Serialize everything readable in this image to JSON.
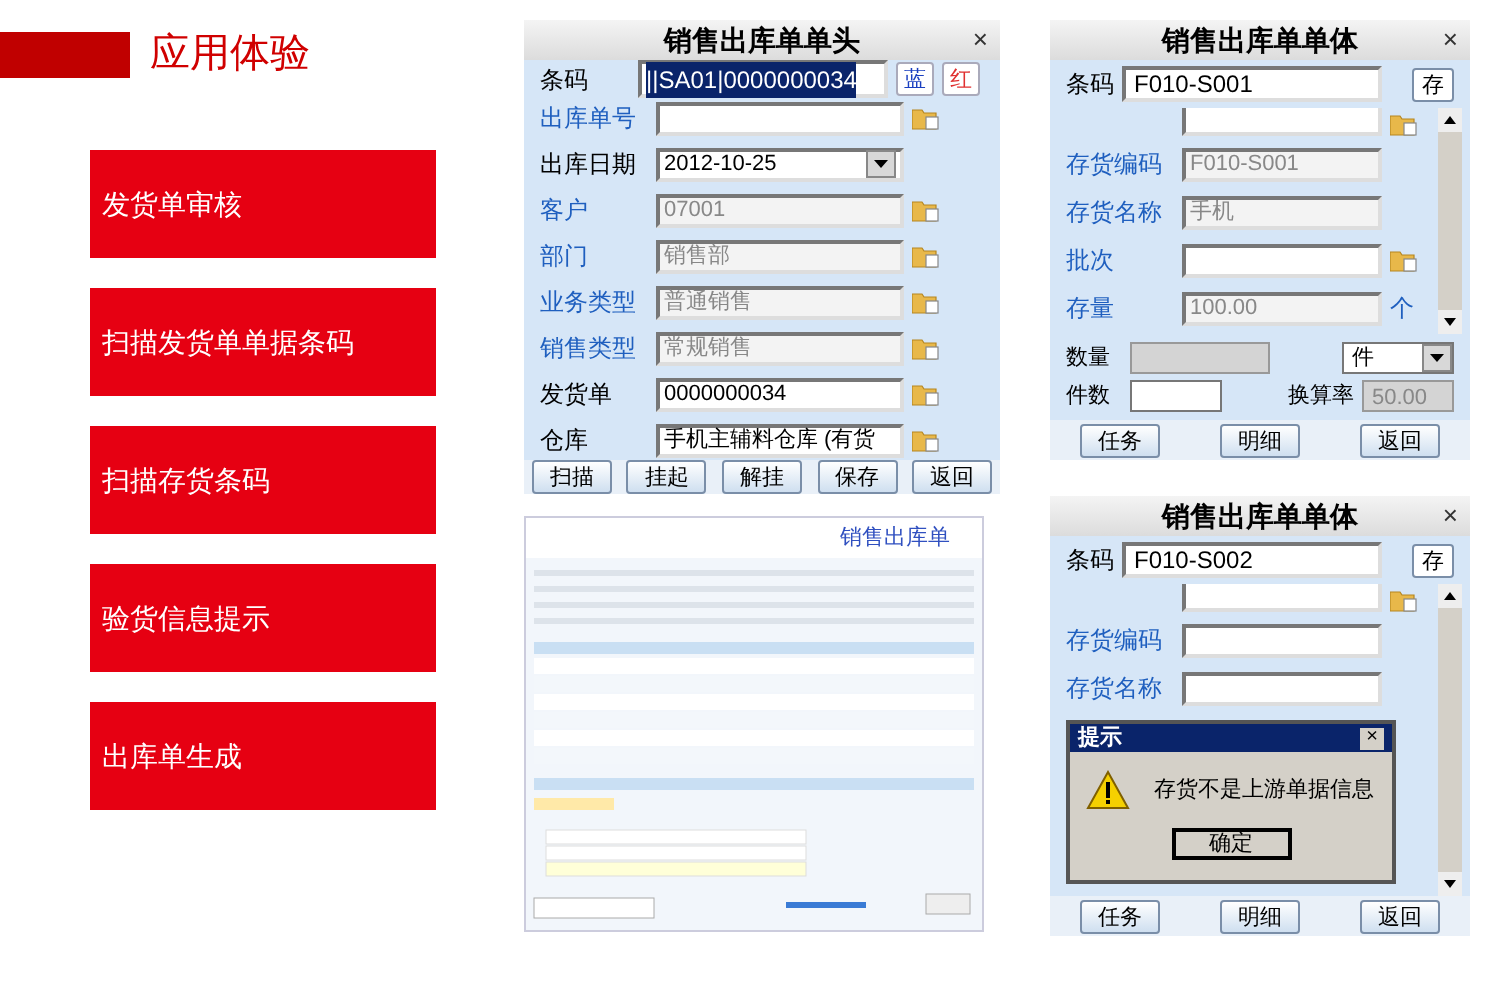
{
  "header": {
    "title": "应用体验"
  },
  "steps": [
    {
      "label": "发货单审核"
    },
    {
      "label": "扫描发货单单据条码"
    },
    {
      "label": "扫描存货条码"
    },
    {
      "label": "验货信息提示"
    },
    {
      "label": "出库单生成"
    }
  ],
  "head_form": {
    "title": "销售出库单单头",
    "close": "×",
    "barcode": {
      "label": "条码",
      "value": "||SA01|0000000034",
      "selected": true
    },
    "color_buttons": [
      {
        "label": "蓝",
        "color": "#1a3fc0"
      },
      {
        "label": "红",
        "color": "#e03030"
      }
    ],
    "fields": [
      {
        "label": "出库单号",
        "linked": true,
        "kind": "lookup",
        "disabled": false
      },
      {
        "label": "出库日期",
        "linked": false,
        "kind": "date",
        "value": "2012-10-25",
        "disabled": false
      },
      {
        "label": "客户",
        "linked": true,
        "kind": "lookup",
        "value": "07001",
        "disabled": true
      },
      {
        "label": "部门",
        "linked": true,
        "kind": "lookup",
        "value": "销售部",
        "disabled": true
      },
      {
        "label": "业务类型",
        "linked": true,
        "kind": "lookup",
        "value": "普通销售",
        "disabled": true
      },
      {
        "label": "销售类型",
        "linked": true,
        "kind": "lookup",
        "value": "常规销售",
        "disabled": true
      },
      {
        "label": "发货单",
        "linked": false,
        "kind": "lookup",
        "value": "0000000034",
        "disabled": false
      },
      {
        "label": "仓库",
        "linked": false,
        "kind": "lookup",
        "value": "手机主辅料仓库 (有货",
        "disabled": false
      }
    ],
    "buttons": [
      "扫描",
      "挂起",
      "解挂",
      "保存",
      "返回"
    ]
  },
  "body_forms": [
    {
      "title": "销售出库单单体",
      "close": "×",
      "barcode": {
        "label": "条码",
        "value": "F010-S001"
      },
      "save": "存",
      "fields": [
        {
          "kind": "lookup",
          "disabled": false
        },
        {
          "label": "存货编码",
          "linked": true,
          "kind": "text",
          "value": "F010-S001",
          "disabled": true
        },
        {
          "label": "存货名称",
          "linked": true,
          "kind": "text",
          "value": "手机",
          "disabled": true
        },
        {
          "label": "批次",
          "linked": true,
          "kind": "lookup",
          "disabled": false
        },
        {
          "label": "存量",
          "linked": true,
          "kind": "text",
          "value": "100.00",
          "disabled": true,
          "unit": "个"
        }
      ],
      "bottom": {
        "quantity": {
          "label": "数量"
        },
        "unit": "件",
        "count": {
          "label": "件数"
        },
        "rate": {
          "label": "换算率",
          "value": "50.00"
        }
      },
      "buttons": [
        "任务",
        "明细",
        "返回"
      ]
    },
    {
      "title": "销售出库单单体",
      "close": "×",
      "barcode": {
        "label": "条码",
        "value": "F010-S002"
      },
      "save": "存",
      "fields": [
        {
          "kind": "lookup",
          "disabled": false
        },
        {
          "label": "存货编码",
          "linked": true,
          "kind": "text",
          "disabled": false
        },
        {
          "label": "存货名称",
          "linked": true,
          "kind": "text",
          "disabled": false
        }
      ],
      "dialog": {
        "title": "提示",
        "close": "×",
        "message": "存货不是上游单据信息",
        "button": "确定"
      },
      "buttons": [
        "任务",
        "明细",
        "返回"
      ]
    }
  ],
  "screenshot": {
    "title": "销售出库单"
  }
}
